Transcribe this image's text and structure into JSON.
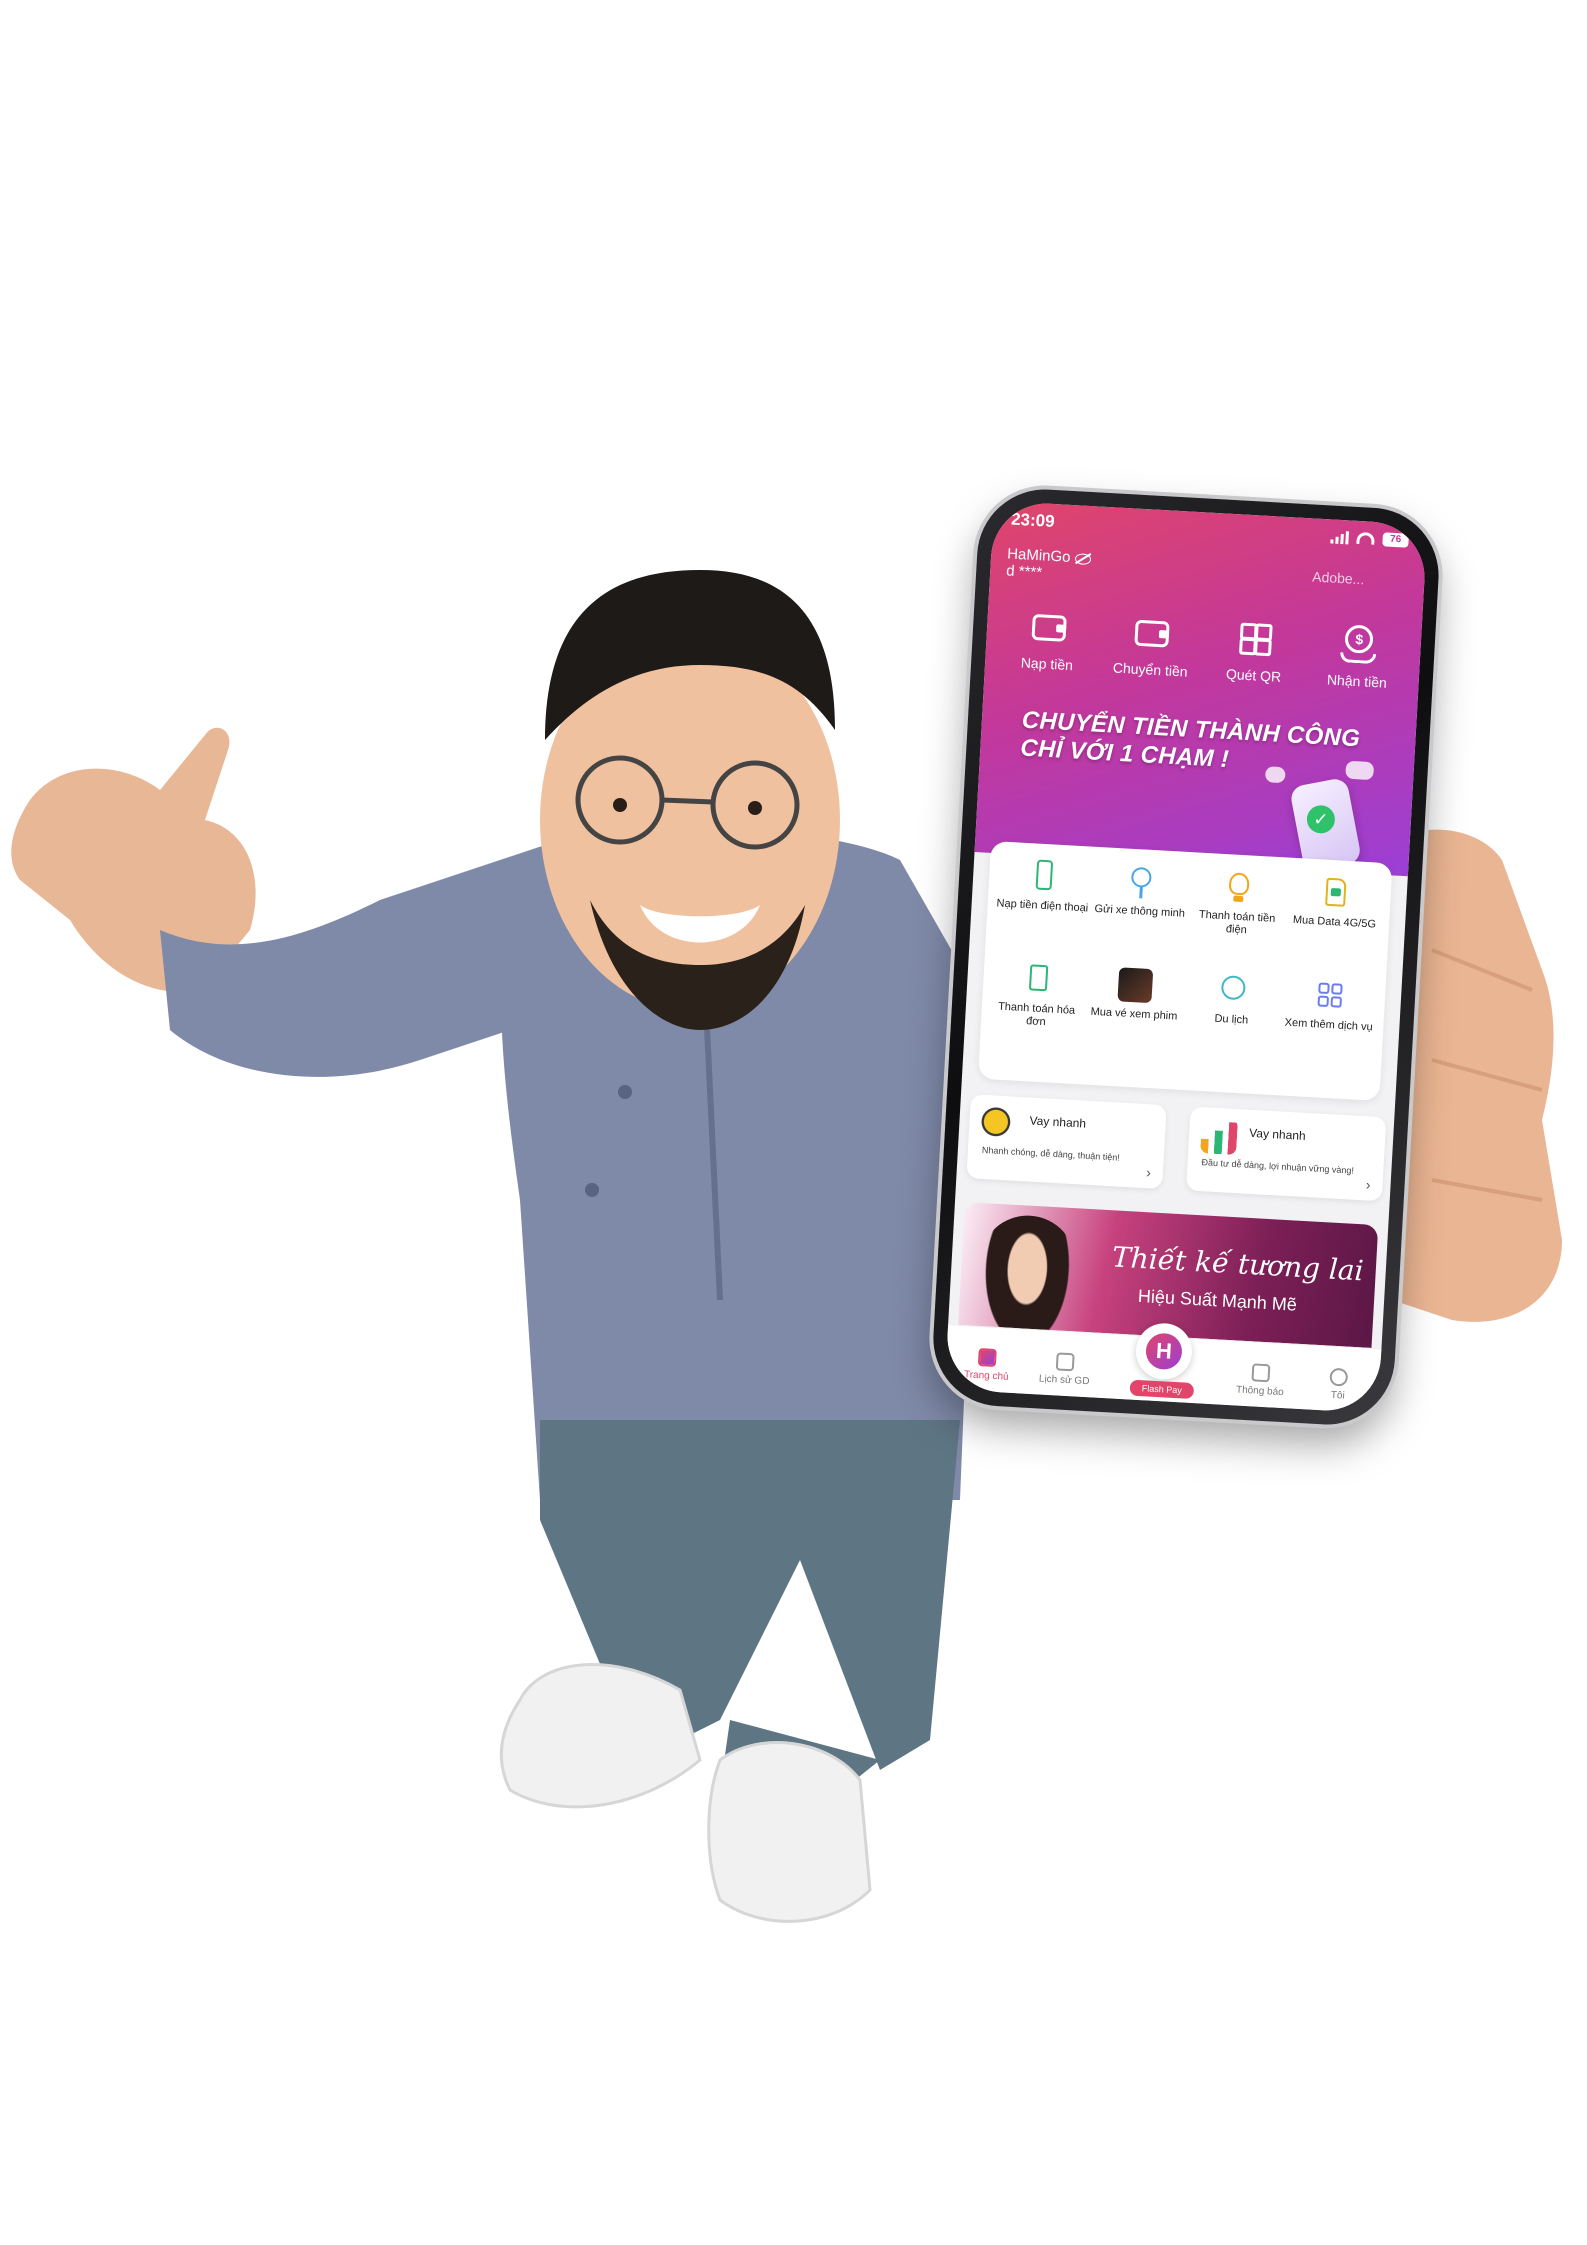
{
  "status_bar": {
    "time": "23:09",
    "battery": "76"
  },
  "account": {
    "name": "HaMinGo",
    "masked": "d ****",
    "right_label": "Adobe..."
  },
  "quick_actions": [
    {
      "label": "Nạp tiền",
      "icon": "wallet-in-icon"
    },
    {
      "label": "Chuyển tiền",
      "icon": "wallet-out-icon"
    },
    {
      "label": "Quét QR",
      "icon": "qr-scan-icon"
    },
    {
      "label": "Nhận tiền",
      "icon": "receive-money-icon"
    }
  ],
  "promo": {
    "line1": "CHUYỂN TIỀN THÀNH CÔNG",
    "line2": "CHỈ VỚI 1 CHẠM !"
  },
  "services": [
    {
      "label": "Nạp tiền điện thoại",
      "icon": "mobile-topup-icon"
    },
    {
      "label": "Gửi xe thông minh",
      "icon": "smart-parking-icon"
    },
    {
      "label": "Thanh toán tiền điện",
      "icon": "electricity-icon"
    },
    {
      "label": "Mua Data 4G/5G",
      "icon": "sim-data-icon"
    },
    {
      "label": "Thanh toán hóa đơn",
      "icon": "bill-icon"
    },
    {
      "label": "Mua vé xem phim",
      "icon": "movie-ticket-icon"
    },
    {
      "label": "Du lịch",
      "icon": "travel-icon"
    },
    {
      "label": "Xem thêm dịch vụ",
      "icon": "more-services-icon"
    }
  ],
  "loans": [
    {
      "title": "Vay nhanh",
      "desc": "Nhanh chóng, dễ dàng, thuận tiện!"
    },
    {
      "title": "Vay nhanh",
      "desc": "Đầu tư dễ dàng, lợi nhuận vững vàng!"
    }
  ],
  "banner": {
    "title": "Thiết kế tương lai",
    "subtitle": "Hiệu Suất Mạnh Mẽ"
  },
  "tabs": {
    "home": "Trang chủ",
    "history": "Lịch sử GD",
    "center": "Flash Pay",
    "notifications": "Thông báo",
    "me": "Tôi"
  },
  "colors": {
    "header_start": "#e0456a",
    "header_end": "#9b3fd6",
    "accent": "#e0456a"
  }
}
